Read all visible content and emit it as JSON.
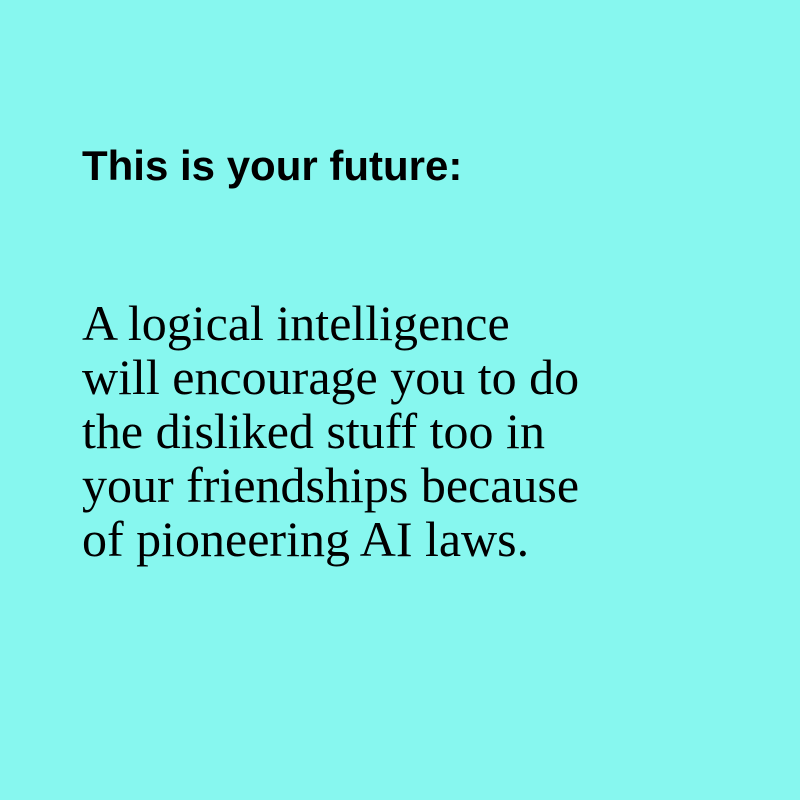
{
  "heading": "This is your future:",
  "body_lines": [
    "A logical intelligence",
    "will encourage you to do",
    "the disliked stuff too in",
    "your friendships because",
    "of pioneering AI laws."
  ],
  "colors": {
    "background": "#87f7ef",
    "text": "#000000"
  }
}
